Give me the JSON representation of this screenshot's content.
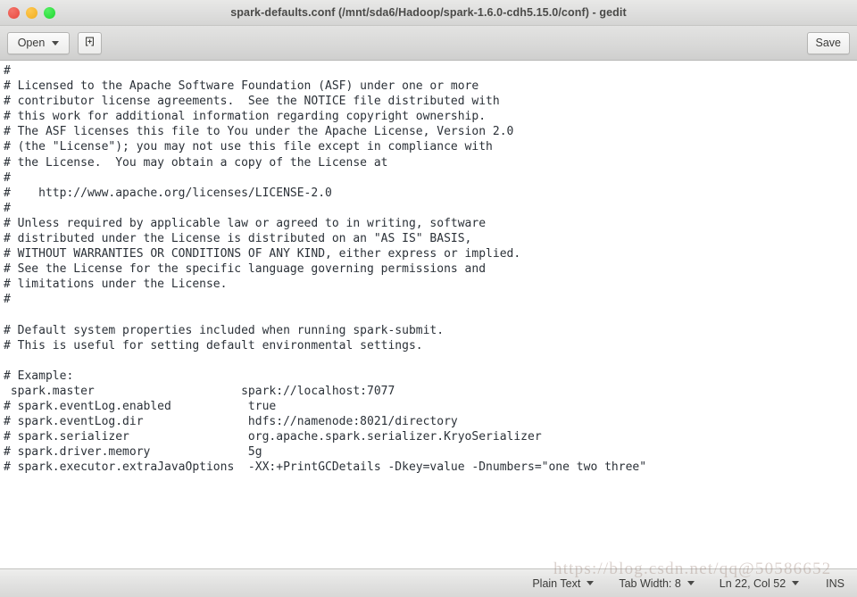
{
  "window": {
    "title": "spark-defaults.conf (/mnt/sda6/Hadoop/spark-1.6.0-cdh5.15.0/conf) - gedit",
    "controls": {
      "close_label": "close",
      "minimize_label": "minimize",
      "maximize_label": "maximize"
    }
  },
  "toolbar": {
    "open_label": "Open",
    "new_document_icon": "new-document-icon",
    "save_label": "Save"
  },
  "editor": {
    "content": "#\n# Licensed to the Apache Software Foundation (ASF) under one or more\n# contributor license agreements.  See the NOTICE file distributed with\n# this work for additional information regarding copyright ownership.\n# The ASF licenses this file to You under the Apache License, Version 2.0\n# (the \"License\"); you may not use this file except in compliance with\n# the License.  You may obtain a copy of the License at\n#\n#    http://www.apache.org/licenses/LICENSE-2.0\n#\n# Unless required by applicable law or agreed to in writing, software\n# distributed under the License is distributed on an \"AS IS\" BASIS,\n# WITHOUT WARRANTIES OR CONDITIONS OF ANY KIND, either express or implied.\n# See the License for the specific language governing permissions and\n# limitations under the License.\n#\n\n# Default system properties included when running spark-submit.\n# This is useful for setting default environmental settings.\n\n# Example:\n spark.master                     spark://localhost:7077\n# spark.eventLog.enabled           true\n# spark.eventLog.dir               hdfs://namenode:8021/directory\n# spark.serializer                 org.apache.spark.serializer.KryoSerializer\n# spark.driver.memory              5g\n# spark.executor.extraJavaOptions  -XX:+PrintGCDetails -Dkey=value -Dnumbers=\"one two three\""
  },
  "statusbar": {
    "language": "Plain Text",
    "tab_width": "Tab Width: 8",
    "cursor_position": "Ln 22, Col 52",
    "insert_mode": "INS"
  },
  "watermark": {
    "text": "https://blog.csdn.net/qq@50586652"
  }
}
